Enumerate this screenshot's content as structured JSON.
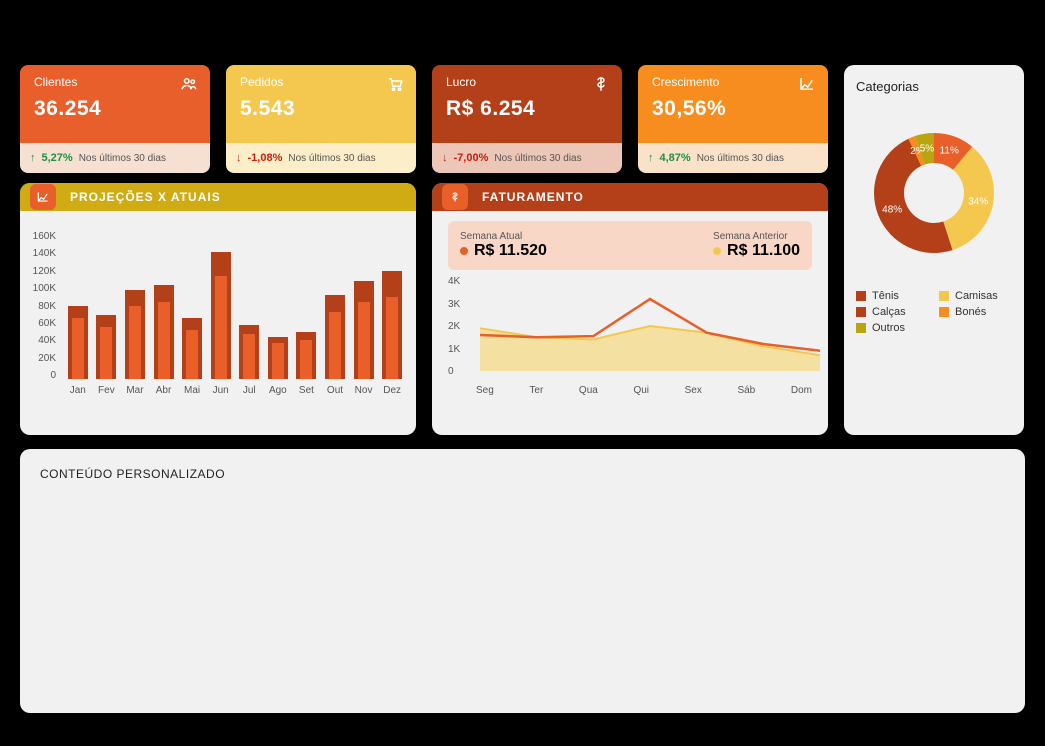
{
  "period_label": "Nos últimos 30 dias",
  "kpis": {
    "clientes": {
      "title": "Clientes",
      "value": "36.254",
      "delta": "5,27%",
      "dir": "up"
    },
    "pedidos": {
      "title": "Pedidos",
      "value": "5.543",
      "delta": "-1,08%",
      "dir": "down"
    },
    "lucro": {
      "title": "Lucro",
      "value": "R$ 6.254",
      "delta": "-7,00%",
      "dir": "down"
    },
    "crescimento": {
      "title": "Crescimento",
      "value": "30,56%",
      "delta": "4,87%",
      "dir": "up"
    }
  },
  "projecoes": {
    "title": "PROJEÇÕES X ATUAIS"
  },
  "faturamento": {
    "title": "FATURAMENTO",
    "atual_label": "Semana Atual",
    "atual_value": "R$ 11.520",
    "anterior_label": "Semana Anterior",
    "anterior_value": "R$ 11.100"
  },
  "categorias": {
    "title": "Categorias",
    "legend": {
      "tenis": "Tênis",
      "camisas": "Camisas",
      "calcas": "Calças",
      "bones": "Bonés",
      "outros": "Outros"
    }
  },
  "custom_title": "CONTEÚDO PERSONALIZADO",
  "chart_data": [
    {
      "id": "projecoes_x_atuais",
      "type": "bar",
      "title": "PROJEÇÕES X ATUAIS",
      "xlabel": "",
      "ylabel": "",
      "categories": [
        "Jan",
        "Fev",
        "Mar",
        "Abr",
        "Mai",
        "Jun",
        "Jul",
        "Ago",
        "Set",
        "Out",
        "Nov",
        "Dez"
      ],
      "series": [
        {
          "name": "Projeção",
          "color": "#b34019",
          "values": [
            78000,
            68000,
            95000,
            100000,
            65000,
            135000,
            58000,
            45000,
            50000,
            90000,
            105000,
            115000
          ]
        },
        {
          "name": "Atual",
          "color": "#e85f29",
          "values": [
            65000,
            55000,
            78000,
            82000,
            52000,
            110000,
            48000,
            38000,
            42000,
            72000,
            82000,
            88000
          ]
        }
      ],
      "ylim": [
        0,
        160000
      ],
      "yticks": [
        0,
        20000,
        40000,
        60000,
        80000,
        100000,
        120000,
        140000,
        160000
      ],
      "ytick_labels": [
        "0",
        "20K",
        "40K",
        "60K",
        "80K",
        "100K",
        "120K",
        "140K",
        "160K"
      ]
    },
    {
      "id": "faturamento_semanal",
      "type": "area",
      "title": "FATURAMENTO",
      "categories": [
        "Seg",
        "Ter",
        "Qua",
        "Qui",
        "Sex",
        "Sáb",
        "Dom"
      ],
      "series": [
        {
          "name": "Semana Atual",
          "color": "#e85f29",
          "values": [
            1600,
            1500,
            1550,
            3200,
            1700,
            1200,
            900
          ]
        },
        {
          "name": "Semana Anterior",
          "color": "#f4c84e",
          "values": [
            1900,
            1500,
            1400,
            2000,
            1700,
            1100,
            700
          ]
        }
      ],
      "ylim": [
        0,
        4000
      ],
      "yticks": [
        0,
        1000,
        2000,
        3000,
        4000
      ],
      "ytick_labels": [
        "0",
        "1K",
        "2K",
        "3K",
        "4K"
      ]
    },
    {
      "id": "categorias",
      "type": "pie",
      "title": "Categorias",
      "slices": [
        {
          "name": "Tênis",
          "value": 11,
          "color": "#e85f29"
        },
        {
          "name": "Camisas",
          "value": 34,
          "color": "#f4c84e"
        },
        {
          "name": "Calças",
          "value": 48,
          "color": "#b34019"
        },
        {
          "name": "Bonés",
          "value": 2,
          "color": "#f68d1e"
        },
        {
          "name": "Outros",
          "value": 5,
          "color": "#b8a50f"
        }
      ]
    }
  ],
  "colors": {
    "orange": "#e85f29",
    "yellow": "#f4c84e",
    "brick": "#b34019",
    "amber": "#f68d1e",
    "olive": "#b8a50f"
  }
}
